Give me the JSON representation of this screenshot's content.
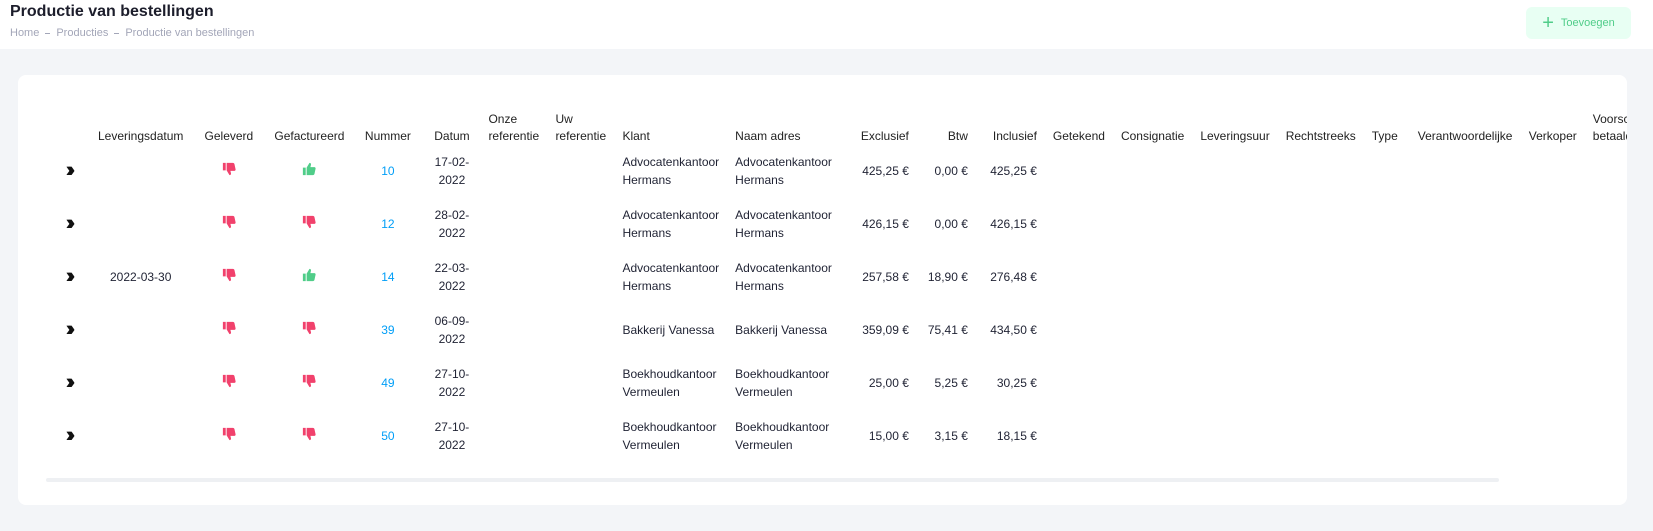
{
  "header": {
    "title": "Productie van bestellingen",
    "breadcrumb": [
      "Home",
      "Producties",
      "Productie van bestellingen"
    ],
    "add_label": "Toevoegen"
  },
  "colors": {
    "accent": "#009ef7",
    "success": "#50cd89",
    "danger": "#f1416c"
  },
  "table": {
    "columns": [
      {
        "key": "expand",
        "label": ""
      },
      {
        "key": "leveringsdatum",
        "label": "Leveringsdatum"
      },
      {
        "key": "geleverd",
        "label": "Geleverd"
      },
      {
        "key": "gefactureerd",
        "label": "Gefactureerd"
      },
      {
        "key": "nummer",
        "label": "Nummer"
      },
      {
        "key": "datum",
        "label": "Datum"
      },
      {
        "key": "onze_referentie",
        "label": "Onze referentie"
      },
      {
        "key": "uw_referentie",
        "label": "Uw referentie"
      },
      {
        "key": "klant",
        "label": "Klant"
      },
      {
        "key": "naam_adres",
        "label": "Naam adres"
      },
      {
        "key": "exclusief",
        "label": "Exclusief"
      },
      {
        "key": "btw",
        "label": "Btw"
      },
      {
        "key": "inclusief",
        "label": "Inclusief"
      },
      {
        "key": "getekend",
        "label": "Getekend"
      },
      {
        "key": "consignatie",
        "label": "Consignatie"
      },
      {
        "key": "leveringsuur",
        "label": "Leveringsuur"
      },
      {
        "key": "rechtstreeks",
        "label": "Rechtstreeks"
      },
      {
        "key": "type",
        "label": "Type"
      },
      {
        "key": "verantwoordelijke",
        "label": "Verantwoordelijke"
      },
      {
        "key": "verkoper",
        "label": "Verkoper"
      },
      {
        "key": "voorschot_betaald",
        "label": "Voorschot betaald"
      }
    ],
    "rows": [
      {
        "leveringsdatum": "",
        "geleverd": "thumbs-down",
        "gefactureerd": "thumbs-up",
        "nummer": "10",
        "datum": "17-02-2022",
        "onze_referentie": "",
        "uw_referentie": "",
        "klant": "Advocatenkantoor Hermans",
        "naam_adres": "Advocatenkantoor Hermans",
        "exclusief": "425,25 €",
        "btw": "0,00 €",
        "inclusief": "425,25 €"
      },
      {
        "leveringsdatum": "",
        "geleverd": "thumbs-down",
        "gefactureerd": "thumbs-down",
        "nummer": "12",
        "datum": "28-02-2022",
        "onze_referentie": "",
        "uw_referentie": "",
        "klant": "Advocatenkantoor Hermans",
        "naam_adres": "Advocatenkantoor Hermans",
        "exclusief": "426,15 €",
        "btw": "0,00 €",
        "inclusief": "426,15 €"
      },
      {
        "leveringsdatum": "2022-03-30",
        "geleverd": "thumbs-down",
        "gefactureerd": "thumbs-up",
        "nummer": "14",
        "datum": "22-03-2022",
        "onze_referentie": "",
        "uw_referentie": "",
        "klant": "Advocatenkantoor Hermans",
        "naam_adres": "Advocatenkantoor Hermans",
        "exclusief": "257,58 €",
        "btw": "18,90 €",
        "inclusief": "276,48 €"
      },
      {
        "leveringsdatum": "",
        "geleverd": "thumbs-down",
        "gefactureerd": "thumbs-down",
        "nummer": "39",
        "datum": "06-09-2022",
        "onze_referentie": "",
        "uw_referentie": "",
        "klant": "Bakkerij Vanessa",
        "naam_adres": "Bakkerij Vanessa",
        "exclusief": "359,09 €",
        "btw": "75,41 €",
        "inclusief": "434,50 €"
      },
      {
        "leveringsdatum": "",
        "geleverd": "thumbs-down",
        "gefactureerd": "thumbs-down",
        "nummer": "49",
        "datum": "27-10-2022",
        "onze_referentie": "",
        "uw_referentie": "",
        "klant": "Boekhoudkantoor Vermeulen",
        "naam_adres": "Boekhoudkantoor Vermeulen",
        "exclusief": "25,00 €",
        "btw": "5,25 €",
        "inclusief": "30,25 €"
      },
      {
        "leveringsdatum": "",
        "geleverd": "thumbs-down",
        "gefactureerd": "thumbs-down",
        "nummer": "50",
        "datum": "27-10-2022",
        "onze_referentie": "",
        "uw_referentie": "",
        "klant": "Boekhoudkantoor Vermeulen",
        "naam_adres": "Boekhoudkantoor Vermeulen",
        "exclusief": "15,00 €",
        "btw": "3,15 €",
        "inclusief": "18,15 €"
      }
    ]
  }
}
